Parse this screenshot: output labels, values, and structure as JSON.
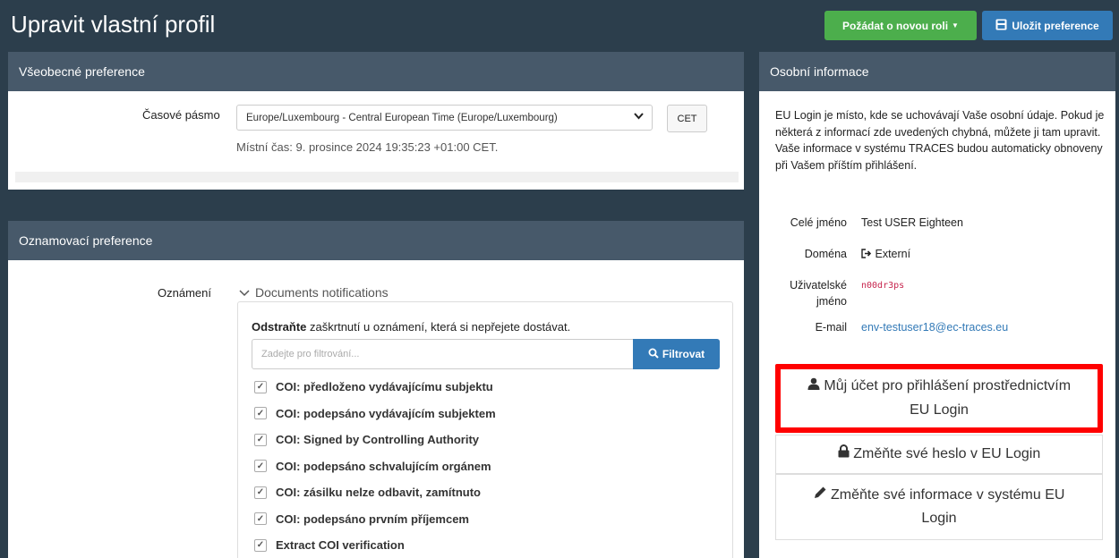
{
  "header": {
    "title": "Upravit vlastní profil",
    "request_role_label": "Požádat o novou roli",
    "save_label": "Uložit preference",
    "colors": {
      "request_role": "#4cae4c",
      "save": "#337ab7"
    }
  },
  "general": {
    "title": "Všeobecné preference",
    "timezone_label": "Časové pásmo",
    "timezone_value": "Europe/Luxembourg - Central European Time (Europe/Luxembourg)",
    "timezone_abbr": "CET",
    "local_time_prefix": "Místní čas:",
    "local_time_value": "9. prosince 2024 19:35:23 +01:00 CET."
  },
  "notifications": {
    "title": "Oznamovací preference",
    "label": "Oznámení",
    "group_label": "Documents notifications",
    "hint_bold": "Odstraňte",
    "hint_rest": "zaškrtnutí u oznámení, která si nepřejete dostávat.",
    "filter_placeholder": "Zadejte pro filtrování...",
    "filter_button": "Filtrovat",
    "items": [
      "COI: předloženo vydávajícímu subjektu",
      "COI: podepsáno vydávajícím subjektem",
      "COI: Signed by Controlling Authority",
      "COI: podepsáno schvalujícím orgánem",
      "COI: zásilku nelze odbavit, zamítnuto",
      "COI: podepsáno prvním příjemcem",
      "Extract COI verification"
    ]
  },
  "personal": {
    "title": "Osobní informace",
    "intro": "EU Login je místo, kde se uchovávají Vaše osobní údaje. Pokud je některá z informací zde uvedených chybná, můžete ji tam upravit. Vaše informace v systému TRACES budou automaticky obnoveny při Vašem příštím přihlášení.",
    "full_name_label": "Celé jméno",
    "full_name": "Test USER Eighteen",
    "domain_label": "Doména",
    "domain": "Externí",
    "username_label_1": "Uživatelské",
    "username_label_2": "jméno",
    "username": "n00dr3ps",
    "email_label": "E-mail",
    "email": "env-testuser18@ec-traces.eu",
    "account_button": "Můj účet pro přihlášení prostřednictvím EU Login",
    "password_button": "Změňte své heslo v EU Login",
    "info_button": "Změňte své informace v systému EU Login"
  }
}
